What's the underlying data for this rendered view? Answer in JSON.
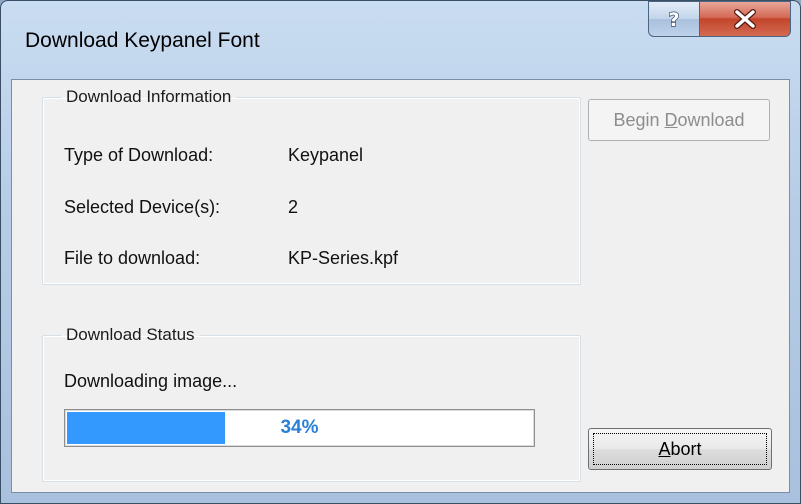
{
  "window": {
    "title": "Download Keypanel Font",
    "help_glyph": "?",
    "close_glyph": "X"
  },
  "info": {
    "legend": "Download Information",
    "rows": [
      {
        "label": "Type of Download:",
        "value": "Keypanel"
      },
      {
        "label": "Selected Device(s):",
        "value": "2"
      },
      {
        "label": "File to download:",
        "value": "KP-Series.kpf"
      }
    ]
  },
  "status": {
    "legend": "Download Status",
    "text": "Downloading image...",
    "progress_text": "34%",
    "progress_fraction": 0.34
  },
  "buttons": {
    "begin_download": {
      "label": "Begin Download",
      "mnemonic": "D",
      "enabled": false
    },
    "abort": {
      "label": "Abort",
      "mnemonic": "A",
      "enabled": true
    }
  },
  "colors": {
    "progress_fill": "#3399ff",
    "progress_text": "#2a7fd6",
    "close_button": "#c2452c",
    "title_bar": "#b7cde7"
  },
  "icons": {
    "help": "help-icon",
    "close": "close-icon"
  }
}
